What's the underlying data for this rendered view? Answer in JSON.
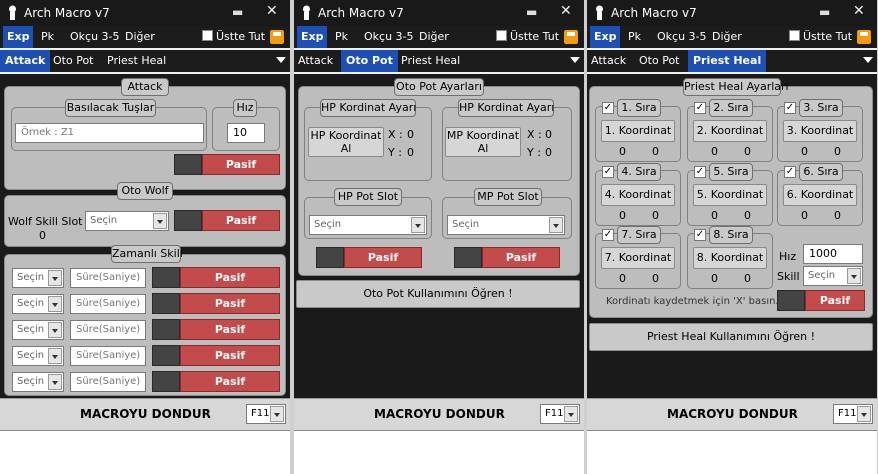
{
  "app_title": "Arch Macro v7",
  "menu": [
    "Exp",
    "Pk",
    "Okçu 3-5",
    "Diğer"
  ],
  "ustte_tut": "Üstte Tut",
  "tabs": [
    "Attack",
    "Oto Pot",
    "Priest Heal"
  ],
  "bottom": {
    "label": "MACROYU DONDUR",
    "key": "F11"
  },
  "attack": {
    "group_title": "Attack",
    "keys_label": "Basılacak Tuşlar",
    "keys_placeholder": "Örnek : Z1",
    "speed_label": "Hız",
    "speed_value": "10",
    "toggle": "Pasif",
    "otowolf_title": "Oto Wolf",
    "wolf_slot_label": "Wolf Skill Slot :",
    "wolf_slot_value": "0",
    "wolf_select": "Seçin",
    "wolf_toggle": "Pasif",
    "timed_title": "Zamanlı Skill",
    "timed_rows": [
      {
        "select": "Seçin",
        "duration": "Süre(Saniye)",
        "toggle": "Pasif"
      },
      {
        "select": "Seçin",
        "duration": "Süre(Saniye)",
        "toggle": "Pasif"
      },
      {
        "select": "Seçin",
        "duration": "Süre(Saniye)",
        "toggle": "Pasif"
      },
      {
        "select": "Seçin",
        "duration": "Süre(Saniye)",
        "toggle": "Pasif"
      },
      {
        "select": "Seçin",
        "duration": "Süre(Saniye)",
        "toggle": "Pasif"
      }
    ]
  },
  "otopot": {
    "group_title": "Oto Pot Ayarları",
    "hp_coord_title": "HP Kordinat Ayarı",
    "mp_coord_title": "HP Kordinat Ayarı",
    "hp_btn": "HP Koordinat Al",
    "mp_btn": "MP Koordinat Al",
    "x_label": "X :",
    "y_label": "Y :",
    "hp_x": "0",
    "hp_y": "0",
    "mp_x": "0",
    "mp_y": "0",
    "hp_slot_title": "HP Pot Slot",
    "mp_slot_title": "MP Pot Slot",
    "hp_select": "Seçin",
    "mp_select": "Seçin",
    "hp_toggle": "Pasif",
    "mp_toggle": "Pasif",
    "learn_btn": "Oto Pot Kullanımını Öğren !"
  },
  "priest": {
    "group_title": "Priest Heal Ayarları",
    "slots": [
      {
        "title": "1. Sıra",
        "btn": "1. Koordinat",
        "x": "0",
        "y": "0",
        "checked": true
      },
      {
        "title": "2. Sıra",
        "btn": "2. Koordinat",
        "x": "0",
        "y": "0",
        "checked": true
      },
      {
        "title": "3. Sıra",
        "btn": "3. Koordinat",
        "x": "0",
        "y": "0",
        "checked": true
      },
      {
        "title": "4. Sıra",
        "btn": "4. Koordinat",
        "x": "0",
        "y": "0",
        "checked": true
      },
      {
        "title": "5. Sıra",
        "btn": "5. Koordinat",
        "x": "0",
        "y": "0",
        "checked": true
      },
      {
        "title": "6. Sıra",
        "btn": "6. Koordinat",
        "x": "0",
        "y": "0",
        "checked": true
      },
      {
        "title": "7. Sıra",
        "btn": "7. Koordinat",
        "x": "0",
        "y": "0",
        "checked": true
      },
      {
        "title": "8. Sıra",
        "btn": "8. Koordinat",
        "x": "0",
        "y": "0",
        "checked": true
      }
    ],
    "speed_label": "Hız",
    "speed_value": "1000",
    "skill_label": "Skill",
    "skill_select": "Seçin",
    "hint": "Kordinatı kaydetmek için 'X' basın.",
    "toggle": "Pasif",
    "learn_btn": "Priest Heal Kullanımını Öğren !"
  }
}
